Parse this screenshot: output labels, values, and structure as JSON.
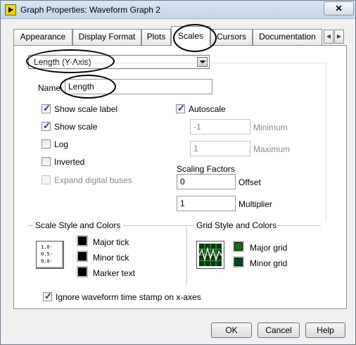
{
  "window": {
    "title": "Graph Properties: Waveform Graph 2",
    "close_label": "✕"
  },
  "tabs": [
    {
      "label": "Appearance"
    },
    {
      "label": "Display Format"
    },
    {
      "label": "Plots"
    },
    {
      "label": "Scales",
      "active": true
    },
    {
      "label": "Cursors"
    },
    {
      "label": "Documentation"
    }
  ],
  "tab_scroll": {
    "left": "◀",
    "right": "▶"
  },
  "axis_select": {
    "value": "Length (Y-Axis)"
  },
  "name_field": {
    "label": "Name",
    "value": "Length"
  },
  "options": {
    "show_scale_label": {
      "label": "Show scale label",
      "checked": true
    },
    "show_scale": {
      "label": "Show scale",
      "checked": true
    },
    "log": {
      "label": "Log",
      "checked": false
    },
    "inverted": {
      "label": "Inverted",
      "checked": false
    },
    "expand_digital_buses": {
      "label": "Expand digital buses",
      "checked": false,
      "disabled": true
    }
  },
  "autoscale": {
    "label": "Autoscale",
    "checked": true,
    "minimum": {
      "value": "-1",
      "label": "Minimum"
    },
    "maximum": {
      "value": "1",
      "label": "Maximum"
    }
  },
  "scaling_factors": {
    "title": "Scaling Factors",
    "offset": {
      "value": "0",
      "label": "Offset"
    },
    "multiplier": {
      "value": "1",
      "label": "Multiplier"
    }
  },
  "scale_style": {
    "title": "Scale Style and Colors",
    "icon_labels": [
      "1.0-",
      "0.5-",
      "0.0-"
    ],
    "major_tick": "Major tick",
    "minor_tick": "Minor tick",
    "marker_text": "Marker text",
    "color": "#000000"
  },
  "grid_style": {
    "title": "Grid Style and Colors",
    "major_grid": {
      "label": "Major grid",
      "color": "#007a00"
    },
    "minor_grid": {
      "label": "Minor grid",
      "color": "#004d1a"
    }
  },
  "ignore_timestamp": {
    "label": "Ignore waveform time stamp on x-axes",
    "checked": true
  },
  "buttons": {
    "ok": "OK",
    "cancel": "Cancel",
    "help": "Help"
  }
}
